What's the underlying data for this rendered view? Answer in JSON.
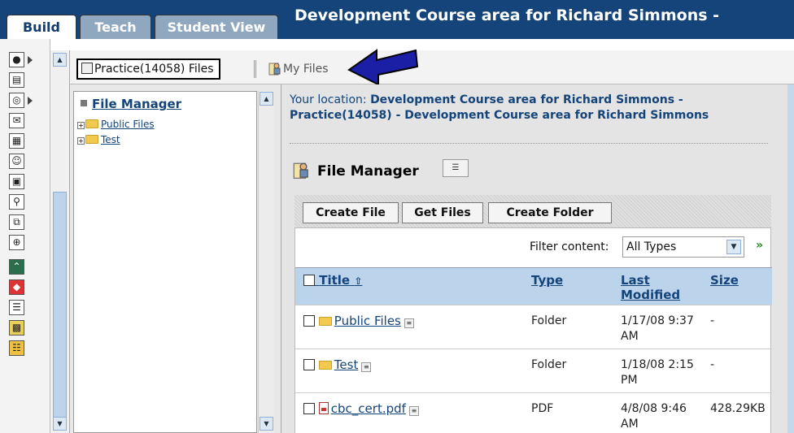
{
  "header": {
    "tabs": [
      {
        "label": "Build",
        "active": true
      },
      {
        "label": "Teach",
        "active": false
      },
      {
        "label": "Student View",
        "active": false
      }
    ],
    "course_title": "Development Course area for Richard Simmons -",
    "accent_color": "#14447a"
  },
  "toolbar": {
    "practice_label": "Practice(14058) Files",
    "myfiles_label": "My Files"
  },
  "tree": {
    "title": "File Manager",
    "items": [
      {
        "label": "Public Files"
      },
      {
        "label": "Test"
      }
    ]
  },
  "main": {
    "location_label": "Your location:",
    "location_value": "Development Course area for Richard Simmons - Practice(14058) - Development Course area for Richard Simmons",
    "heading": "File Manager",
    "buttons": {
      "create_file": "Create File",
      "get_files": "Get Files",
      "create_folder": "Create Folder"
    },
    "filter": {
      "label": "Filter content:",
      "selected": "All Types"
    },
    "columns": {
      "title": "Title",
      "type": "Type",
      "last_modified": "Last Modified",
      "size": "Size"
    },
    "rows": [
      {
        "name": "Public Files",
        "type": "Folder",
        "modified": "1/17/08 9:37 AM",
        "size": "-"
      },
      {
        "name": "Test",
        "type": "Folder",
        "modified": "1/18/08 2:15 PM",
        "size": "-"
      },
      {
        "name": "cbc_cert.pdf",
        "type": "PDF",
        "modified": "4/8/08 9:46 AM",
        "size": "428.29KB"
      }
    ]
  },
  "icons": [
    "apple-icon",
    "document-icon",
    "disc-icon",
    "envelope-icon",
    "page-icon",
    "people-icon",
    "scorm-icon",
    "magnifier-icon",
    "copy-icon",
    "globe-icon",
    "collapse-icon",
    "cube-icon",
    "files-icon",
    "grid-icon",
    "quiz-icon"
  ]
}
